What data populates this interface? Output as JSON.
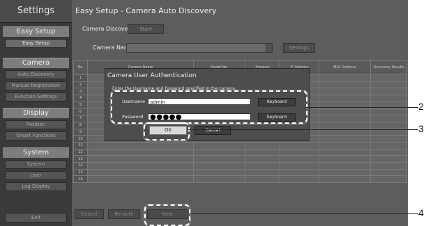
{
  "sidebar": {
    "title": "Settings",
    "sections": [
      {
        "label": "Easy Setup",
        "items": [
          "Easy Setup"
        ]
      },
      {
        "label": "Camera",
        "items": [
          "Auto Discovery",
          "Manual Registration",
          "Function Settings"
        ]
      },
      {
        "label": "Display",
        "items": [
          "Position",
          "Smart Functions"
        ]
      },
      {
        "label": "System",
        "items": [
          "System",
          "User",
          "Log Display"
        ]
      }
    ],
    "exit_label": "Exit"
  },
  "main": {
    "title": "Easy Setup - Camera Auto Discovery",
    "camera_discovery_label": "Camera Discovery",
    "start_label": "Start",
    "camera_name_label": "Camera Name",
    "settings_label": "Settings",
    "table": {
      "headers": [
        "No.",
        "Camera Name",
        "Model No.",
        "Protocol",
        "IP Address",
        "MAC Address",
        "Discovery Results"
      ],
      "rows": [
        "1",
        "2",
        "3",
        "4",
        "5",
        "6",
        "7",
        "8",
        "9",
        "10",
        "11",
        "12",
        "13",
        "14",
        "15",
        "16"
      ]
    },
    "bottom_buttons": [
      "Cancel",
      "Re-auth",
      "Next"
    ]
  },
  "dialog": {
    "title": "Camera User Authentication",
    "message": "Enter the Username and Password specified in the camera.",
    "username_label": "Username",
    "username_value": "admin",
    "password_label": "Password",
    "password_value": "●●●●●",
    "keyboard_label": "Keyboard",
    "ok_label": "OK",
    "cancel_label": "Cancel"
  },
  "callouts": [
    "2",
    "3",
    "4"
  ]
}
